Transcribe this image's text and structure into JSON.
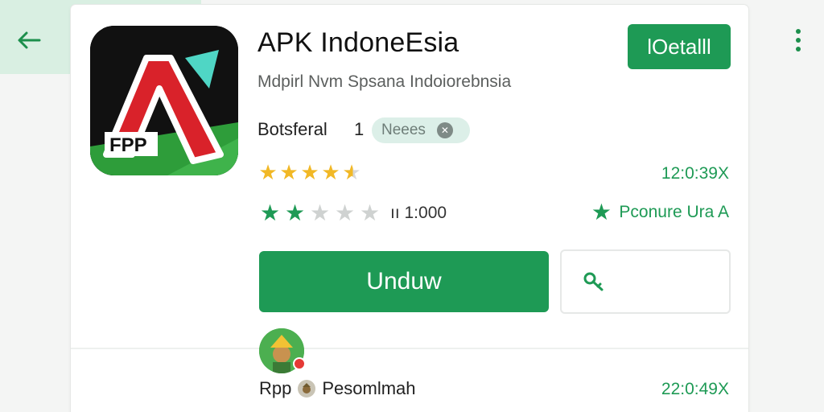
{
  "header": {
    "back_icon": "arrow-left-icon",
    "more_icon": "more-vert-icon"
  },
  "app": {
    "title": "APK IndoneEsia",
    "subtitle": "Mdpirl Nvm Spsana Indoiorebnsia",
    "icon_text": "FPP",
    "install_label": "lOetalll",
    "developer": "Botsferal",
    "developer_count": "1",
    "tag_label": "Neees",
    "tag_icon": "close-circle-icon"
  },
  "ratings": {
    "row1_stars_filled": 4.5,
    "row1_value": "12:0:39X",
    "row2_stars_filled": 2,
    "row2_count": "ıı 1:000",
    "badge_icon": "star-icon",
    "badge_label": "Pconure Ura A"
  },
  "actions": {
    "download_label": "Unduw",
    "share_icon": "link-icon"
  },
  "review": {
    "avatar_icon": "user-avatar-icon",
    "user_prefix": "Rpp",
    "user_icon": "badge-icon",
    "user_name": "Pesomlmah",
    "value": "22:0:49X"
  },
  "colors": {
    "accent": "#1e9a55",
    "star_gold": "#f1b826",
    "header_tint": "#d9efe2"
  }
}
